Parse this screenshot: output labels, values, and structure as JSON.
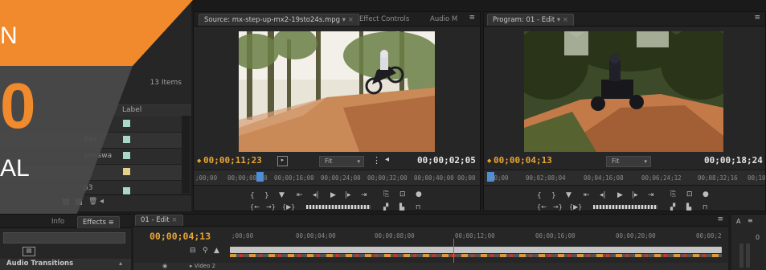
{
  "project": {
    "item_count": "13 Items",
    "column_label": "Label",
    "rows": [
      {
        "name": "",
        "color": "#a8d8c8"
      },
      {
        "name": "24s",
        "color": "#a8d8c8"
      },
      {
        "name": "am-swa",
        "color": "#a8d8c8"
      },
      {
        "name": "",
        "color": "#e6d08a"
      },
      {
        "name": "p3",
        "color": "#a8d8c8"
      }
    ]
  },
  "overlay": {
    "line1": "N",
    "line2": "0",
    "line3": "AL",
    "brand_color": "#f08a2c"
  },
  "source": {
    "tab_source": "Source: mx-step-up-mx2-19sto24s.mpg",
    "tab_effect_controls": "Effect Controls",
    "tab_audio": "Audio M",
    "current_tc": "00;00;11;23",
    "duration_tc": "00;00;02;05",
    "fit": "Fit",
    "ruler": [
      ";00;00",
      "00;00;08;00",
      "00;00;16;00",
      "00;00;24;00",
      "00;00;32;00",
      "00;00;40;00",
      "00;00"
    ]
  },
  "program": {
    "tab_program": "Program: 01 - Edit",
    "current_tc": "00;00;04;13",
    "duration_tc": "00;00;18;24",
    "fit": "Fit",
    "ruler": [
      "00;00",
      "00;02;08;04",
      "00;04;16;08",
      "00;06;24;12",
      "00;08;32;16",
      "00;10"
    ]
  },
  "effects": {
    "tab_info": "Info",
    "tab_effects": "Effects",
    "audio_transitions": "Audio Transitions"
  },
  "timeline": {
    "tab": "01 - Edit",
    "current_tc": "00;00;04;13",
    "ruler": [
      ";00;00",
      "00;00;04;00",
      "00;00;08;00",
      "00;00;12;00",
      "00;00;16;00",
      "00;00;20;00",
      "00;00;2"
    ],
    "track": "Video 2"
  },
  "audio_panel": {
    "tab": "A",
    "meter_value": "0"
  },
  "icons": [
    "wrench-icon",
    "marker-icon",
    "step-back-icon",
    "play-icon",
    "step-forward-icon",
    "insert-icon",
    "overwrite-icon",
    "export-frame-icon",
    "camera-icon"
  ]
}
